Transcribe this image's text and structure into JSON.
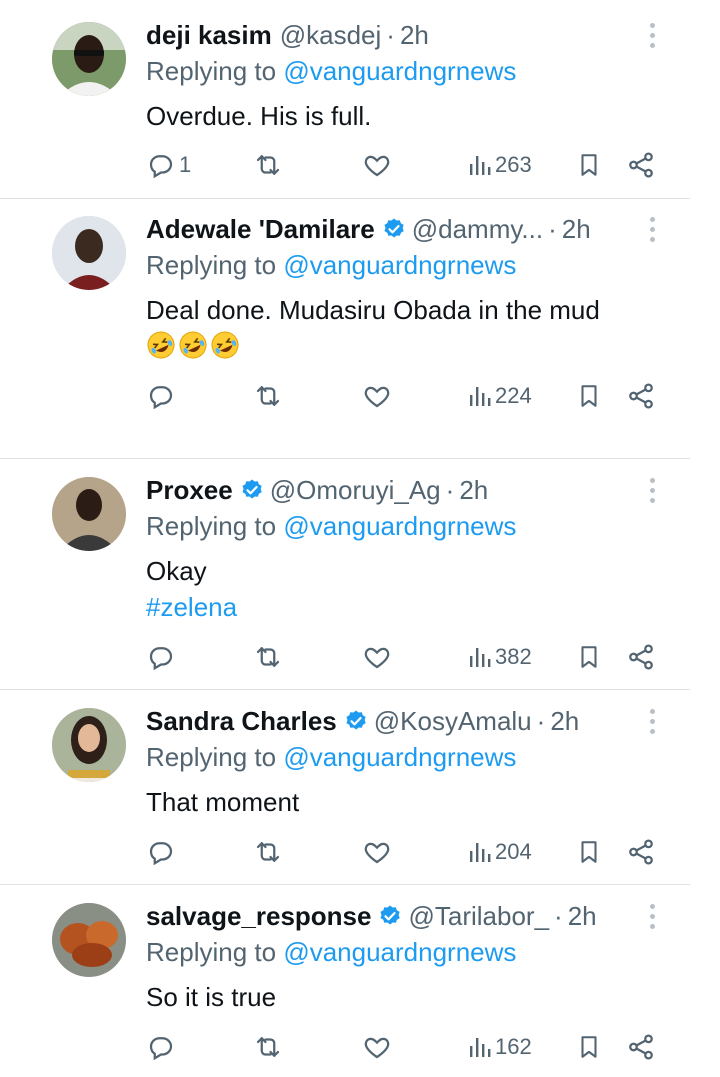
{
  "replying_label": "Replying to",
  "replies": [
    {
      "name": "deji kasim",
      "verified": false,
      "handle": "@kasdej",
      "dot": "·",
      "time": "2h",
      "replying_to": "@vanguardngrnews",
      "text": "Overdue. His is full.",
      "emoji": [],
      "hashtag": "",
      "reply_count": "1",
      "retweet_count": "",
      "like_count": "",
      "views": "263",
      "avatar_color": "#6b8a5a"
    },
    {
      "name": "Adewale 'Damilare",
      "verified": true,
      "handle": "@dammy...",
      "dot": "·",
      "time": "2h",
      "replying_to": "@vanguardngrnews",
      "text": "Deal done. Mudasiru Obada in the mud",
      "emoji": [
        "rolling-on-floor-laughing",
        "rolling-on-floor-laughing",
        "rolling-on-floor-laughing"
      ],
      "hashtag": "",
      "reply_count": "",
      "retweet_count": "",
      "like_count": "",
      "views": "224",
      "avatar_color": "#d6dde3"
    },
    {
      "name": "Proxee",
      "verified": true,
      "handle": "@Omoruyi_Ag",
      "dot": "·",
      "time": "2h",
      "replying_to": "@vanguardngrnews",
      "text": "Okay",
      "emoji": [],
      "hashtag": "#zelena",
      "reply_count": "",
      "retweet_count": "",
      "like_count": "",
      "views": "382",
      "avatar_color": "#8c7d6b"
    },
    {
      "name": "Sandra Charles",
      "verified": true,
      "handle": "@KosyAmalu",
      "dot": "·",
      "time": "2h",
      "replying_to": "@vanguardngrnews",
      "text": "That moment",
      "emoji": [],
      "hashtag": "",
      "reply_count": "",
      "retweet_count": "",
      "like_count": "",
      "views": "204",
      "avatar_color": "#9aa48c"
    },
    {
      "name": "salvage_response",
      "verified": true,
      "handle": "@Tarilabor_",
      "dot": "·",
      "time": "2h",
      "replying_to": "@vanguardngrnews",
      "text": "So it is true",
      "emoji": [],
      "hashtag": "",
      "reply_count": "",
      "retweet_count": "",
      "like_count": "",
      "views": "162",
      "avatar_color": "#a8552e"
    }
  ],
  "icons": {
    "reply": "reply-icon",
    "retweet": "retweet-icon",
    "like": "like-icon",
    "views": "views-icon",
    "bookmark": "bookmark-icon",
    "share": "share-icon",
    "more": "more-icon",
    "verified": "verified-badge-icon"
  },
  "colors": {
    "link": "#1d9bf0",
    "muted": "#536471",
    "text": "#0f1419",
    "divider": "#dfe3e6",
    "verified": "#1d9bf0"
  }
}
